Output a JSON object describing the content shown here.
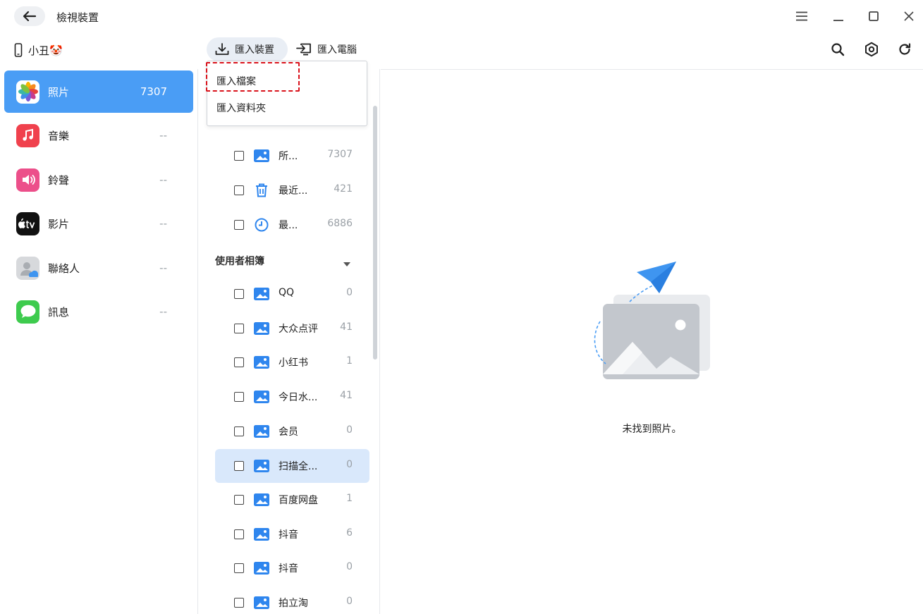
{
  "window": {
    "title": "檢視裝置"
  },
  "toolbar": {
    "device_name": "小丑🤡",
    "import_device_label": "匯入裝置",
    "import_pc_label": "匯入電腦"
  },
  "dropdown": {
    "items": [
      {
        "label": "匯入檔案"
      },
      {
        "label": "匯入資料夾"
      }
    ]
  },
  "sidebar": {
    "items": [
      {
        "label": "照片",
        "count": "7307",
        "icon": "photos-icon"
      },
      {
        "label": "音樂",
        "count": "--",
        "icon": "music-icon"
      },
      {
        "label": "鈴聲",
        "count": "--",
        "icon": "ringtone-icon"
      },
      {
        "label": "影片",
        "count": "--",
        "icon": "apple-tv-icon"
      },
      {
        "label": "聯絡人",
        "count": "--",
        "icon": "contacts-icon"
      },
      {
        "label": "訊息",
        "count": "--",
        "icon": "messages-icon"
      }
    ]
  },
  "albums": {
    "system_items": [
      {
        "name": "所...",
        "count": "7307",
        "icon": "album-icon"
      },
      {
        "name": "最近...",
        "count": "421",
        "icon": "trash-icon"
      },
      {
        "name": "最...",
        "count": "6886",
        "icon": "clock-icon"
      }
    ],
    "user_section_title": "使用者相簿",
    "user_items": [
      {
        "name": "QQ",
        "count": "0"
      },
      {
        "name": "大众点评",
        "count": "41"
      },
      {
        "name": "小红书",
        "count": "1"
      },
      {
        "name": "今日水...",
        "count": "41"
      },
      {
        "name": "会员",
        "count": "0"
      },
      {
        "name": "扫描全...",
        "count": "0"
      },
      {
        "name": "百度网盘",
        "count": "1"
      },
      {
        "name": "抖音",
        "count": "6"
      },
      {
        "name": "抖音",
        "count": "0"
      },
      {
        "name": "拍立淘",
        "count": "0"
      }
    ]
  },
  "main": {
    "empty_text": "未找到照片。"
  },
  "colors": {
    "accent": "#4a9df5",
    "selected_row": "#d9e8fb",
    "highlight_border": "#d9121b"
  }
}
